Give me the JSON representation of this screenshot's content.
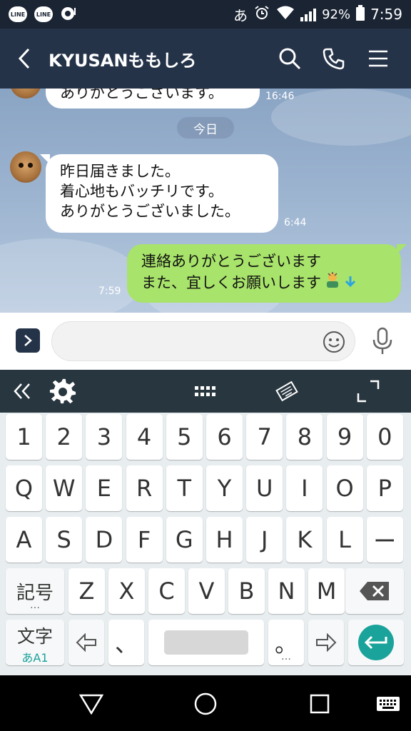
{
  "status_bar": {
    "notif1": "LINE",
    "notif2": "LINE",
    "ime": "あ",
    "battery": "92%",
    "time": "7:59"
  },
  "header": {
    "title": "KYUSANももしろ"
  },
  "chat": {
    "partial_text": "ありがとうございます。",
    "partial_time": "16:46",
    "date_label": "今日",
    "incoming": {
      "lines": [
        "昨日届きました。",
        "着心地もバッチリです。",
        "ありがとうございました。"
      ],
      "time": "6:44"
    },
    "outgoing": {
      "lines": [
        "連絡ありがとうございます",
        "また、宜しくお願いします"
      ],
      "time": "7:59"
    }
  },
  "input": {
    "placeholder": ""
  },
  "keyboard": {
    "rows": [
      [
        "1",
        "2",
        "3",
        "4",
        "5",
        "6",
        "7",
        "8",
        "9",
        "0"
      ],
      [
        "Q",
        "W",
        "E",
        "R",
        "T",
        "Y",
        "U",
        "I",
        "O",
        "P"
      ],
      [
        "A",
        "S",
        "D",
        "F",
        "G",
        "H",
        "J",
        "K",
        "L",
        "ー"
      ]
    ],
    "row4_letters": [
      "Z",
      "X",
      "C",
      "V",
      "B",
      "N",
      "M"
    ],
    "symbol_key": "記号",
    "symbol_sub": "…",
    "mode_key": "文字",
    "mode_sub": "あA1",
    "comma_key": "、",
    "period_key": "。",
    "period_sub": "…"
  },
  "colors": {
    "header_bg": "#253349",
    "my_bubble": "#a8e36b",
    "enter_key": "#1aa39a"
  }
}
